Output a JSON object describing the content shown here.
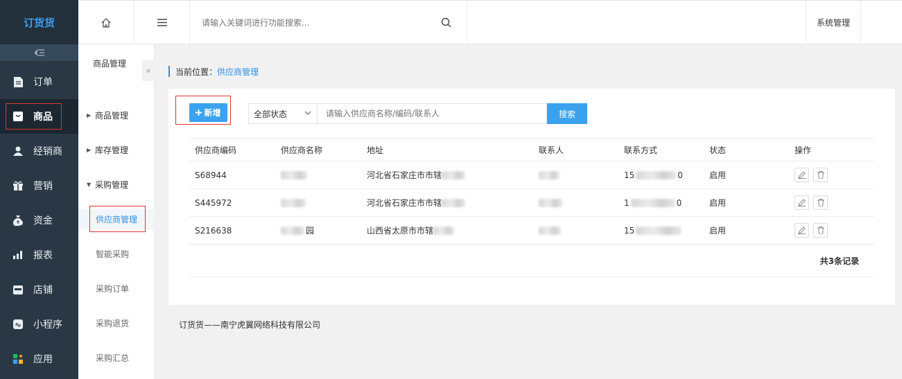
{
  "sidebar": {
    "logo": "订货货",
    "items": [
      {
        "label": "订单",
        "icon": "document-icon"
      },
      {
        "label": "商品",
        "icon": "product-icon"
      },
      {
        "label": "经销商",
        "icon": "user-icon"
      },
      {
        "label": "营销",
        "icon": "gift-icon"
      },
      {
        "label": "资金",
        "icon": "money-bag-icon"
      },
      {
        "label": "报表",
        "icon": "bar-chart-icon"
      },
      {
        "label": "店铺",
        "icon": "shop-icon"
      },
      {
        "label": "小程序",
        "icon": "mini-program-icon"
      },
      {
        "label": "应用",
        "icon": "apps-icon"
      }
    ]
  },
  "topbar": {
    "search_placeholder": "请输入关键词进行功能搜索...",
    "system_management": "系统管理"
  },
  "subsidebar": {
    "title": "商品管理",
    "groups": [
      "商品管理",
      "库存管理",
      "采购管理"
    ],
    "links": [
      "供应商管理",
      "智能采购",
      "采购订单",
      "采购退货",
      "采购汇总"
    ]
  },
  "breadcrumb": {
    "prefix": "当前位置：",
    "current": "供应商管理"
  },
  "toolbar": {
    "add_label": "新增",
    "status_value": "全部状态",
    "keyword_placeholder": "请输入供应商名称/编码/联系人",
    "search_label": "搜索"
  },
  "table": {
    "headers": [
      "供应商编码",
      "供应商名称",
      "地址",
      "联系人",
      "联系方式",
      "状态",
      "操作"
    ],
    "rows": [
      {
        "code": "S68944",
        "name_visible": "",
        "address": "河北省石家庄市市辖",
        "contact_visible": "",
        "phone_prefix": "15",
        "phone_suffix": "0",
        "status": "启用"
      },
      {
        "code": "S445972",
        "name_visible": "",
        "address": "河北省石家庄市市辖",
        "contact_visible": "",
        "phone_prefix": "1",
        "phone_suffix": "0",
        "status": "启用"
      },
      {
        "code": "S216638",
        "name_visible": "园",
        "address": "山西省太原市市辖",
        "contact_visible": "",
        "phone_prefix": "15",
        "phone_suffix": "",
        "status": "启用"
      }
    ],
    "total": "共3条记录"
  },
  "footer": {
    "text": "订货货——南宁虎翼网络科技有限公司"
  },
  "colors": {
    "accent": "#3aa2ef",
    "sidebar_bg": "#2a3845",
    "highlight_red": "#e0342f",
    "link_blue": "#2d8fe3"
  }
}
